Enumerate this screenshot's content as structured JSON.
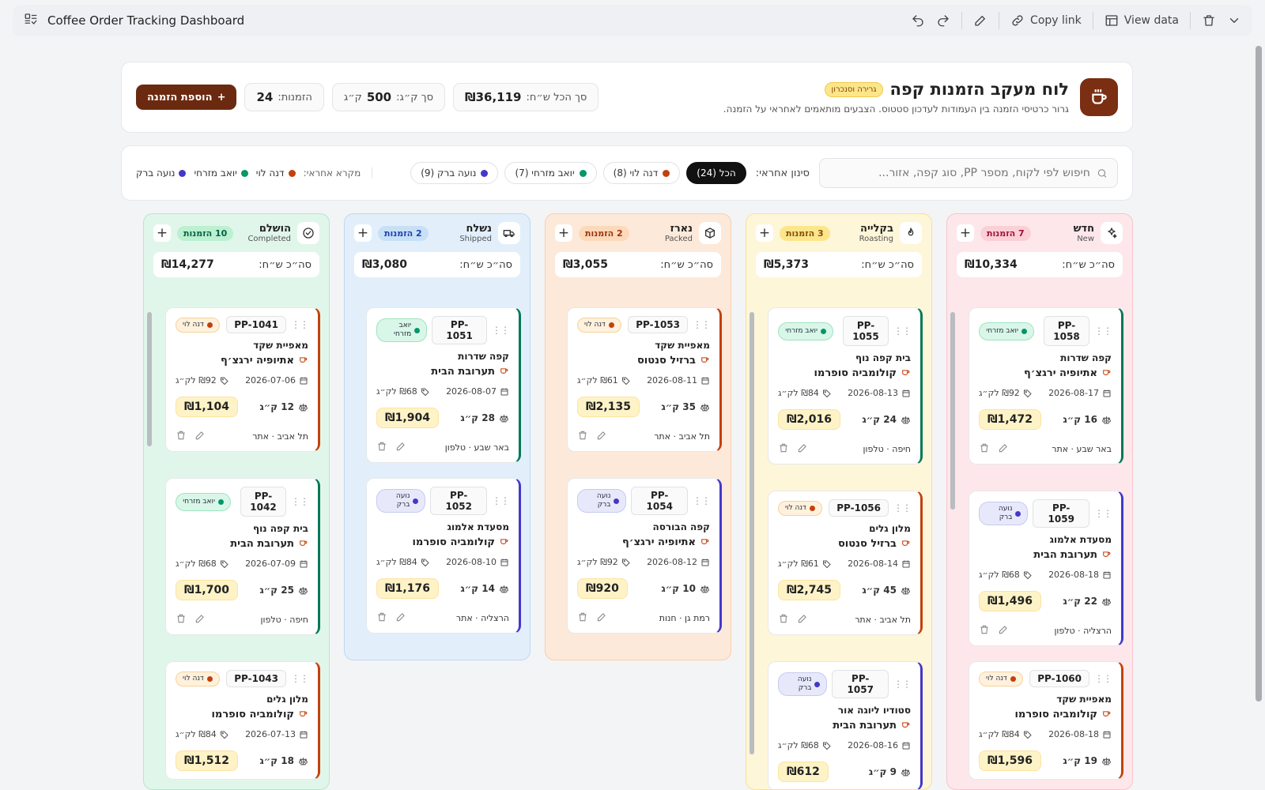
{
  "topbar": {
    "title": "Coffee Order Tracking Dashboard",
    "copy_link": "Copy link",
    "view_data": "View data"
  },
  "header": {
    "title": "לוח מעקב הזמנות קפה",
    "badge": "גרירה וסנכרון",
    "subtitle": "גרור כרטיסי הזמנה בין העמודות לעדכון סטטוס. הצבעים מותאמים לאחראי על הזמנה.",
    "total_label": "סך הכל ש״ח:",
    "total_value": "₪36,119",
    "kg_label": "סך ק״ג:",
    "kg_value": "500",
    "kg_unit": "ק״ג",
    "orders_label": "הזמנות:",
    "orders_value": "24",
    "add_button": "הוספת הזמנה"
  },
  "filters": {
    "search_placeholder": "חיפוש לפי לקוח, מספר PP, סוג קפה, אזור...",
    "label": "סינון אחראי:",
    "chips": [
      {
        "label": "הכל (24)",
        "color": ""
      },
      {
        "label": "דנה לוי (8)",
        "color": "#c2410c"
      },
      {
        "label": "יואב מזרחי (7)",
        "color": "#059669"
      },
      {
        "label": "נועה ברק (9)",
        "color": "#4338ca"
      }
    ],
    "legend_label": "מקרא אחראי:",
    "legend": [
      {
        "label": "דנה לוי",
        "color": "#c2410c"
      },
      {
        "label": "יואב מזרחי",
        "color": "#059669"
      },
      {
        "label": "נועה ברק",
        "color": "#4338ca"
      }
    ]
  },
  "total_prefix": "סה״כ ש״ח:",
  "columns": [
    {
      "name": "חדש",
      "en": "New",
      "count": "7 הזמנות",
      "total": "₪10,334",
      "icon": "sparkles-icon",
      "bg": "#fde7ea",
      "border": "#f7c5cc",
      "badge_bg": "#fbcfd6",
      "badge_fg": "#9f1239",
      "cards": [
        {
          "pp": "PP-1058",
          "owner": "יואב מזרחי",
          "customer": "קפה שדרות",
          "coffee": "אתיופיה ירגצ׳ף",
          "date": "2026-08-17",
          "ppkg": "₪92 לק״ג",
          "qty": "16 ק״ג",
          "price": "₪1,472",
          "location": "באר שבע · אתר"
        },
        {
          "pp": "PP-1059",
          "owner": "נועה ברק",
          "customer": "מסעדת אלמוג",
          "coffee": "תערובת הבית",
          "date": "2026-08-18",
          "ppkg": "₪68 לק״ג",
          "qty": "22 ק״ג",
          "price": "₪1,496",
          "location": "הרצליה · טלפון"
        },
        {
          "pp": "PP-1060",
          "owner": "דנה לוי",
          "customer": "מאפיית שקד",
          "coffee": "קולומביה סופרמו",
          "date": "2026-08-18",
          "ppkg": "₪84 לק״ג",
          "qty": "19 ק״ג",
          "price": "₪1,596",
          "location": ""
        }
      ]
    },
    {
      "name": "בקלייה",
      "en": "Roasting",
      "count": "3 הזמנות",
      "total": "₪5,373",
      "icon": "flame-icon",
      "bg": "#fef6d8",
      "border": "#f6e29a",
      "badge_bg": "#fde68a",
      "badge_fg": "#854d0e",
      "cards": [
        {
          "pp": "PP-1055",
          "owner": "יואב מזרחי",
          "customer": "בית קפה נוף",
          "coffee": "קולומביה סופרמו",
          "date": "2026-08-13",
          "ppkg": "₪84 לק״ג",
          "qty": "24 ק״ג",
          "price": "₪2,016",
          "location": "חיפה · טלפון"
        },
        {
          "pp": "PP-1056",
          "owner": "דנה לוי",
          "customer": "מלון גלים",
          "coffee": "ברזיל סנטוס",
          "date": "2026-08-14",
          "ppkg": "₪61 לק״ג",
          "qty": "45 ק״ג",
          "price": "₪2,745",
          "location": "תל אביב · אתר"
        },
        {
          "pp": "PP-1057",
          "owner": "נועה ברק",
          "customer": "סטודיו ליוגה אור",
          "coffee": "תערובת הבית",
          "date": "2026-08-16",
          "ppkg": "₪68 לק״ג",
          "qty": "9 ק״ג",
          "price": "₪612",
          "location": ""
        }
      ]
    },
    {
      "name": "נארז",
      "en": "Packed",
      "count": "2 הזמנות",
      "total": "₪3,055",
      "icon": "box-icon",
      "bg": "#fde9d9",
      "border": "#f8cfae",
      "badge_bg": "#fcd9b8",
      "badge_fg": "#9a3412",
      "cards": [
        {
          "pp": "PP-1053",
          "owner": "דנה לוי",
          "customer": "מאפיית שקד",
          "coffee": "ברזיל סנטוס",
          "date": "2026-08-11",
          "ppkg": "₪61 לק״ג",
          "qty": "35 ק״ג",
          "price": "₪2,135",
          "location": "תל אביב · אתר"
        },
        {
          "pp": "PP-1054",
          "owner": "נועה ברק",
          "customer": "קפה הבורסה",
          "coffee": "אתיופיה ירגצ׳ף",
          "date": "2026-08-12",
          "ppkg": "₪92 לק״ג",
          "qty": "10 ק״ג",
          "price": "₪920",
          "location": "רמת גן · חנות"
        }
      ]
    },
    {
      "name": "נשלח",
      "en": "Shipped",
      "count": "2 הזמנות",
      "total": "₪3,080",
      "icon": "truck-icon",
      "bg": "#e2effb",
      "border": "#bcd9f2",
      "badge_bg": "#c7e0f6",
      "badge_fg": "#1e40af",
      "cards": [
        {
          "pp": "PP-1051",
          "owner": "יואב מזרחי",
          "customer": "קפה שדרות",
          "coffee": "תערובת הבית",
          "date": "2026-08-07",
          "ppkg": "₪68 לק״ג",
          "qty": "28 ק״ג",
          "price": "₪1,904",
          "location": "באר שבע · טלפון"
        },
        {
          "pp": "PP-1052",
          "owner": "נועה ברק",
          "customer": "מסעדת אלמוג",
          "coffee": "קולומביה סופרמו",
          "date": "2026-08-10",
          "ppkg": "₪84 לק״ג",
          "qty": "14 ק״ג",
          "price": "₪1,176",
          "location": "הרצליה · אתר"
        }
      ]
    },
    {
      "name": "הושלם",
      "en": "Completed",
      "count": "10 הזמנות",
      "total": "₪14,277",
      "icon": "check-circle-icon",
      "bg": "#e1f6ea",
      "border": "#b7e6cb",
      "badge_bg": "#bbf0d0",
      "badge_fg": "#065f46",
      "cards": [
        {
          "pp": "PP-1041",
          "owner": "דנה לוי",
          "customer": "מאפיית שקד",
          "coffee": "אתיופיה ירגצ׳ף",
          "date": "2026-07-06",
          "ppkg": "₪92 לק״ג",
          "qty": "12 ק״ג",
          "price": "₪1,104",
          "location": "תל אביב · אתר"
        },
        {
          "pp": "PP-1042",
          "owner": "יואב מזרחי",
          "customer": "בית קפה נוף",
          "coffee": "תערובת הבית",
          "date": "2026-07-09",
          "ppkg": "₪68 לק״ג",
          "qty": "25 ק״ג",
          "price": "₪1,700",
          "location": "חיפה · טלפון"
        },
        {
          "pp": "PP-1043",
          "owner": "דנה לוי",
          "customer": "מלון גלים",
          "coffee": "קולומביה סופרמו",
          "date": "2026-07-13",
          "ppkg": "₪84 לק״ג",
          "qty": "18 ק״ג",
          "price": "₪1,512",
          "location": ""
        }
      ]
    }
  ],
  "owner_colors": {
    "דנה לוי": {
      "dot": "#c2410c",
      "bg": "#fff1dc",
      "border": "#f7d29a",
      "stripe": "#c2410c"
    },
    "יואב מזרחי": {
      "dot": "#059669",
      "bg": "#d9f7e8",
      "border": "#9fe2c0",
      "stripe": "#047857"
    },
    "נועה ברק": {
      "dot": "#4338ca",
      "bg": "#e7e9fb",
      "border": "#c5cbf3",
      "stripe": "#4338ca"
    }
  }
}
